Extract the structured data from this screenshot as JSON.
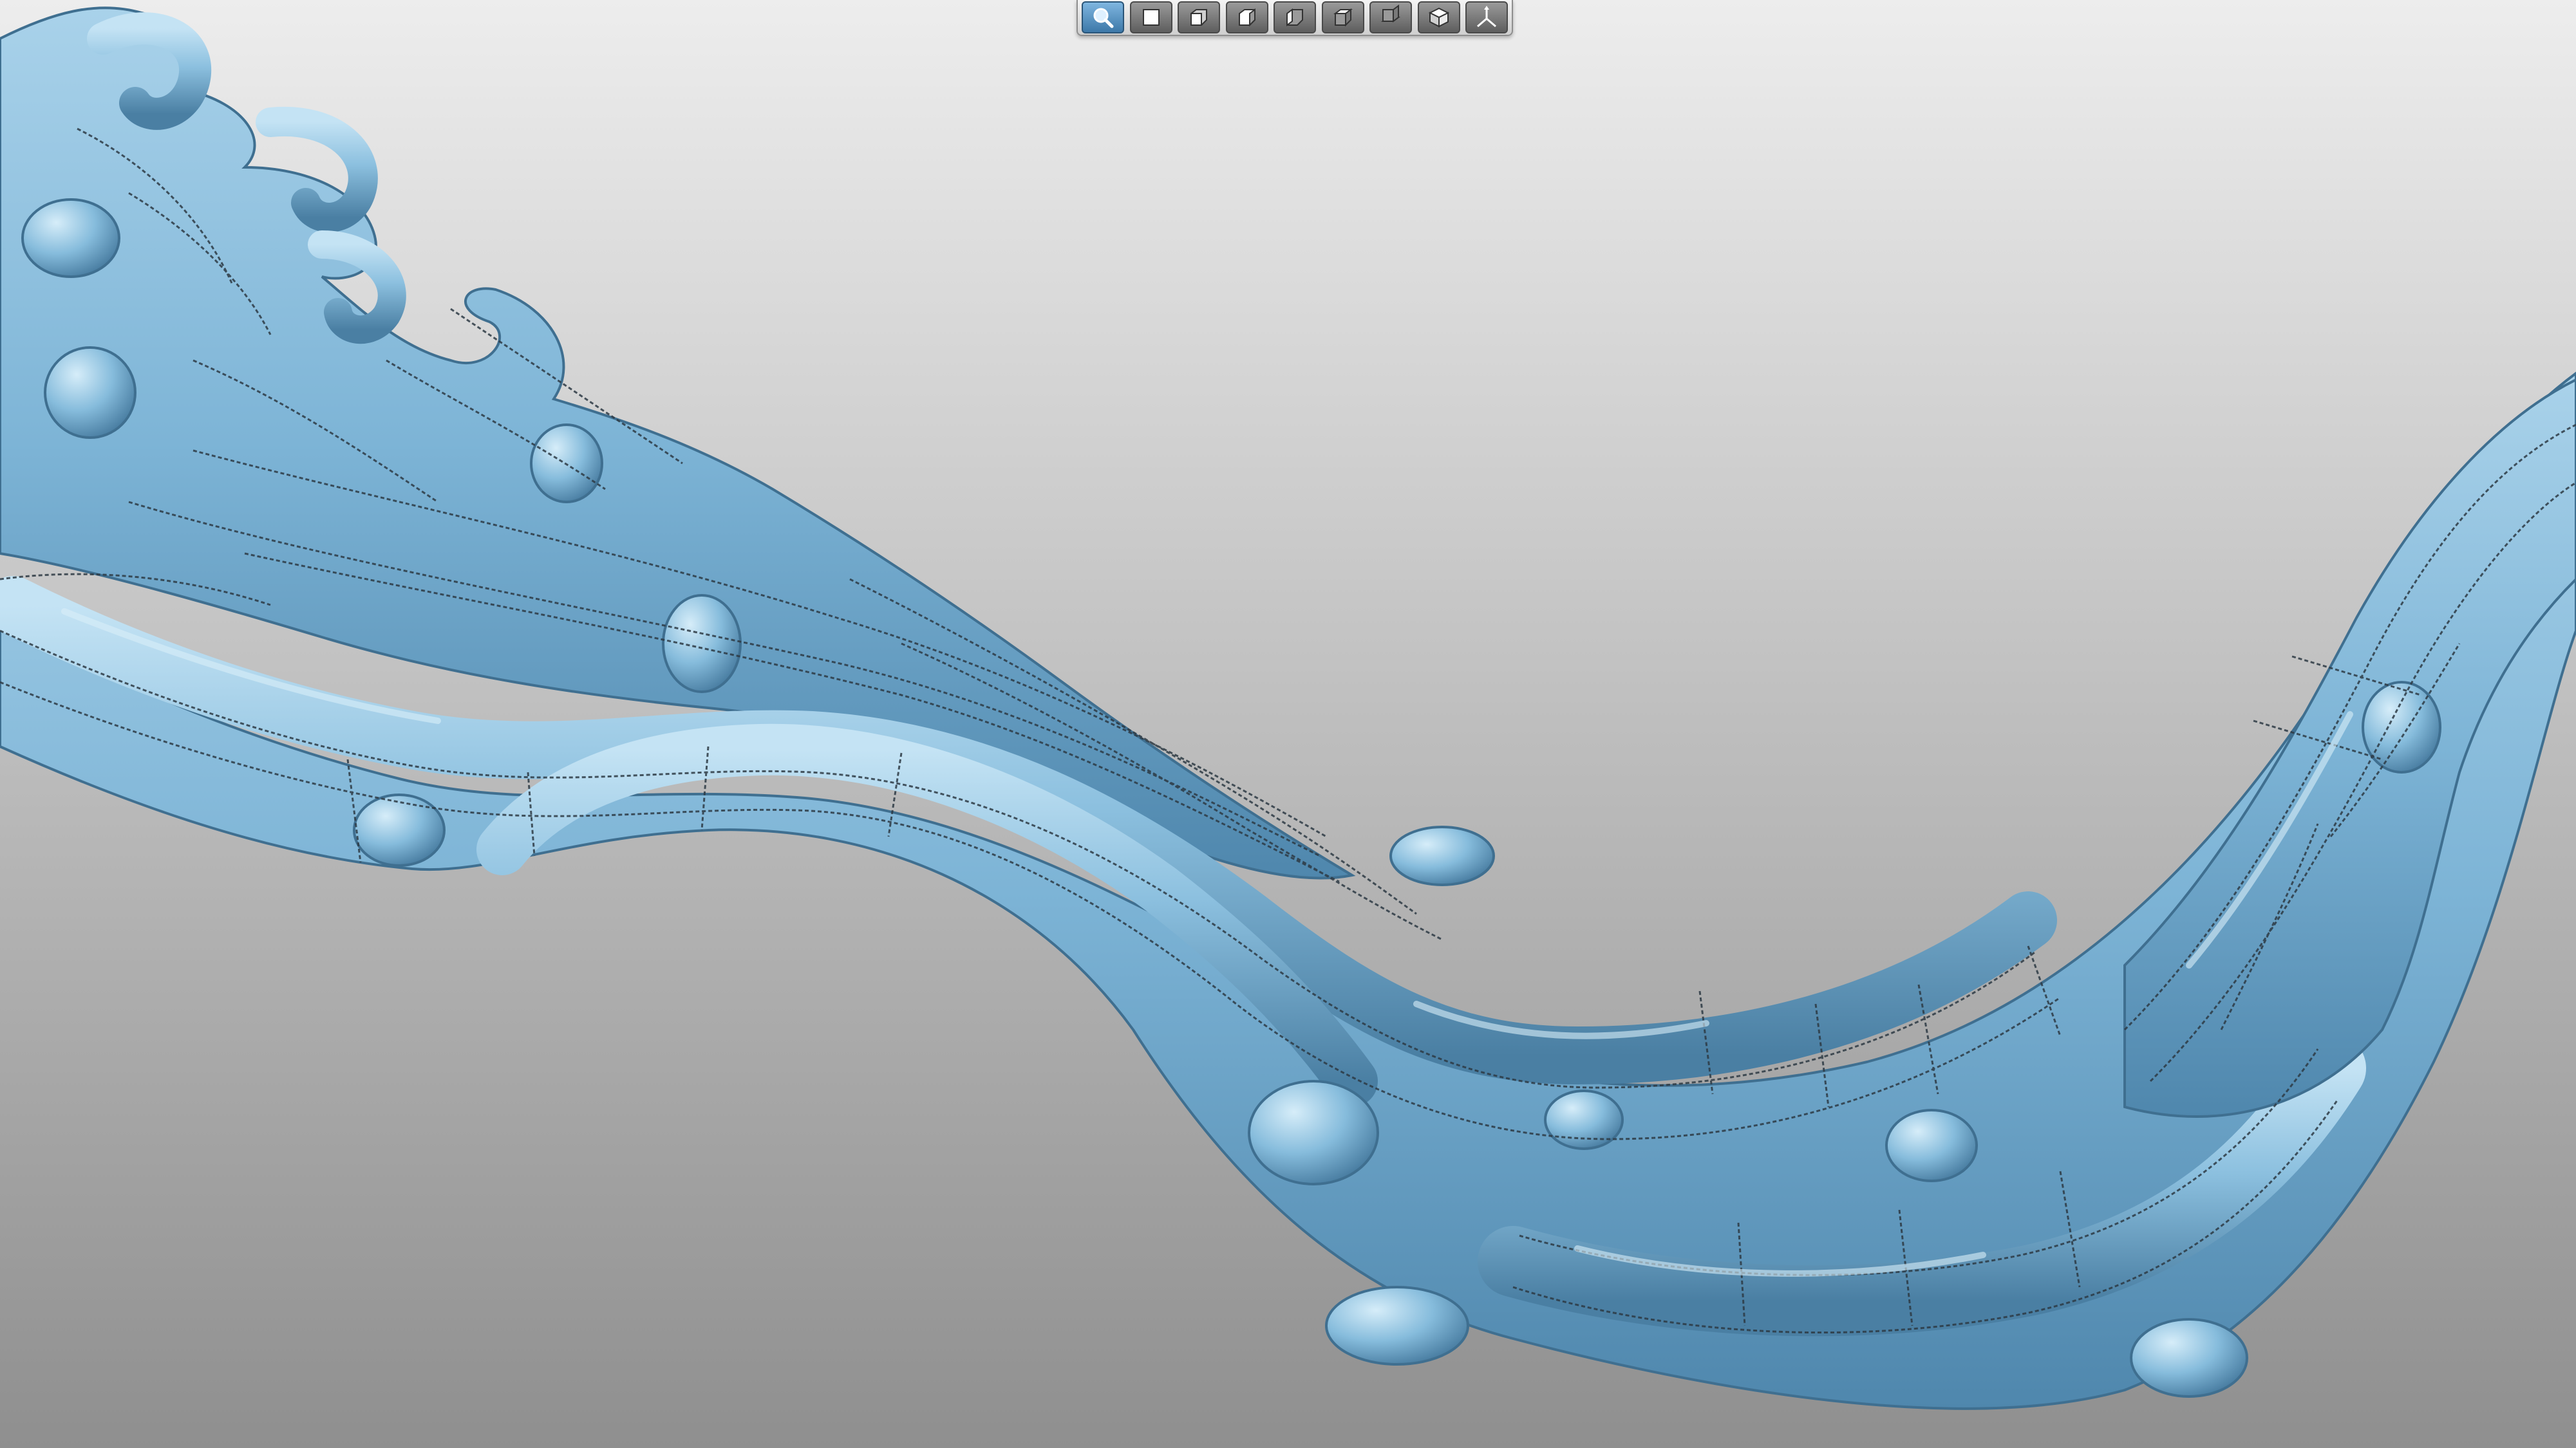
{
  "viewport": {
    "background_top": "#ededed",
    "background_bottom": "#8f8f8f",
    "model_color": "#7db4d6",
    "model_shade": "#4f87ad",
    "model_highlight": "#bfe0f2",
    "wire_color": "#2d3a44"
  },
  "toolbar": {
    "buttons": [
      {
        "name": "zoom-fit-icon",
        "active": true
      },
      {
        "name": "view-front-icon"
      },
      {
        "name": "view-back-icon"
      },
      {
        "name": "view-left-icon"
      },
      {
        "name": "view-right-icon"
      },
      {
        "name": "view-top-icon"
      },
      {
        "name": "view-bottom-icon"
      },
      {
        "name": "view-isometric-icon"
      },
      {
        "name": "axis-triad-icon"
      }
    ]
  }
}
